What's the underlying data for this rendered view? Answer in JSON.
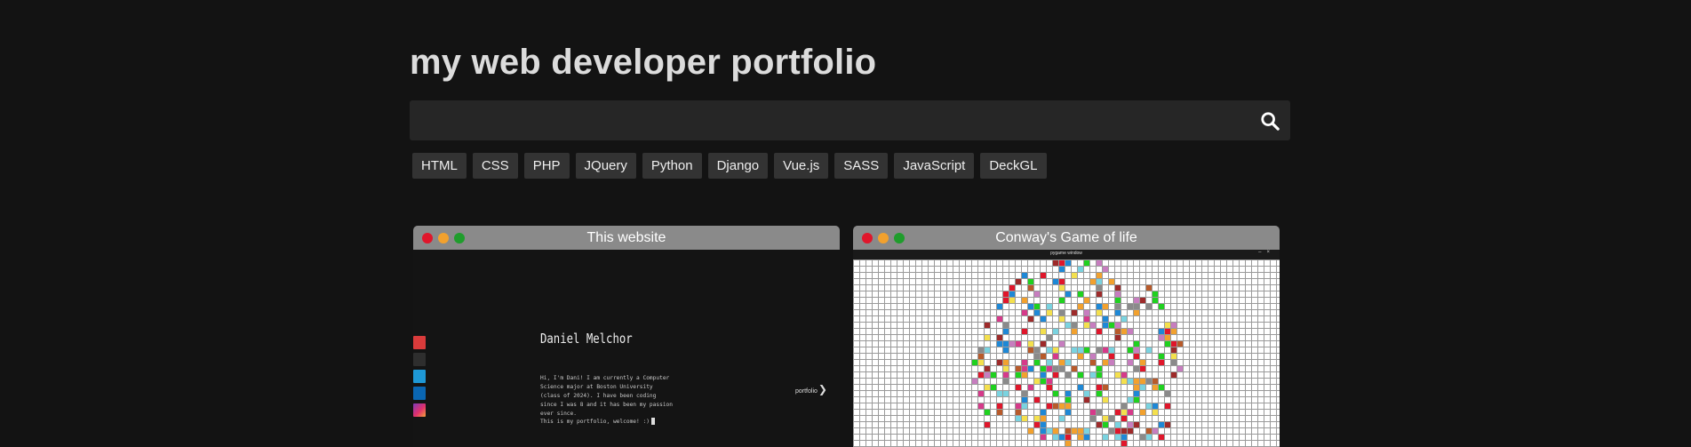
{
  "page": {
    "title": "my web developer portfolio"
  },
  "search": {
    "value": "",
    "placeholder": "",
    "icon": "search-icon"
  },
  "tags": [
    "HTML",
    "CSS",
    "PHP",
    "JQuery",
    "Python",
    "Django",
    "Vue.js",
    "SASS",
    "JavaScript",
    "DeckGL"
  ],
  "colors": {
    "background": "#131313",
    "window_titlebar": "#8a8a8a",
    "dot_red": "#e0162b",
    "dot_yellow": "#f2a12e",
    "dot_green": "#1f9d2c"
  },
  "projects": [
    {
      "title": "This website",
      "preview": {
        "name": "Daniel Melchor",
        "bio": "Hi, I'm Dani! I am currently a Computer Science major at Boston University (class of 2024). I have been coding since I was 8 and it has been my passion ever since.",
        "welcome": "This is my portfolio, welcome! :)",
        "nav_label": "portfolio",
        "social_icons": [
          "email-icon",
          "github-icon",
          "twitter-icon",
          "linkedin-icon",
          "instagram-icon"
        ]
      }
    },
    {
      "title": "Conway's Game of life",
      "preview": {
        "window_title": "pygame window"
      }
    }
  ]
}
